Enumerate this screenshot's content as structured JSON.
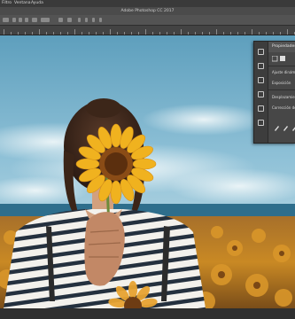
{
  "menubar": {
    "items": [
      "Filtro",
      "Ventana",
      "Ayuda"
    ]
  },
  "window": {
    "title": "Adobe Photoshop CC 2017"
  },
  "properties_panel": {
    "title": "Propiedades",
    "rows": [
      "Ajuste dinámico",
      "Exposición",
      "Desplazamiento",
      "Corrección de"
    ],
    "icons": [
      "brush-icon",
      "text-icon",
      "layers-icon",
      "adjust-icon",
      "swap-icon",
      "person-icon"
    ]
  }
}
